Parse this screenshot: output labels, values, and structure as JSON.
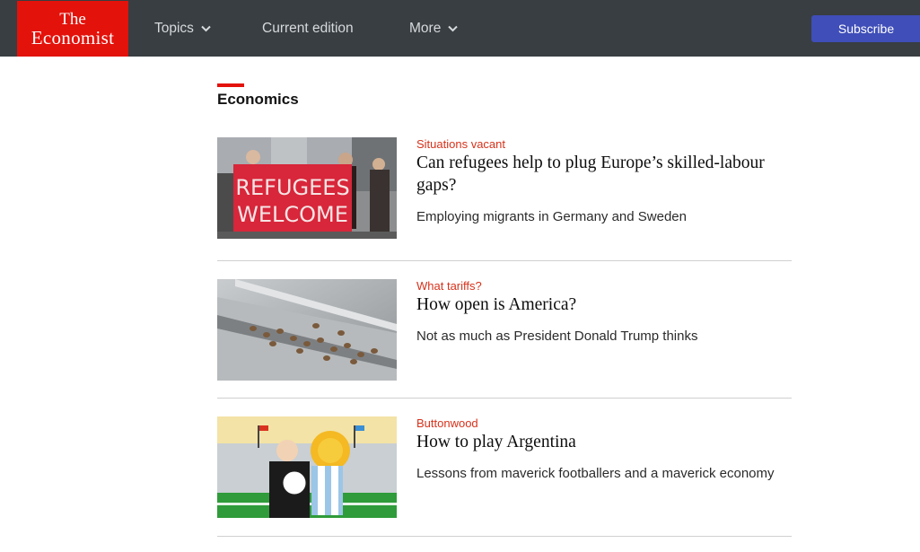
{
  "header": {
    "logo_line1": "The",
    "logo_line2": "Economist",
    "nav": [
      {
        "label": "Topics",
        "icon": "chevron-down-icon"
      },
      {
        "label": "Current edition"
      },
      {
        "label": "More",
        "icon": "chevron-down-icon"
      }
    ],
    "subscribe_label": "Subscribe",
    "colors": {
      "bar": "#383e42",
      "logo": "#e3120b",
      "subscribe": "#3f4eb8"
    }
  },
  "section": {
    "title": "Economics",
    "accent": "#e3120b"
  },
  "articles": [
    {
      "flytitle": "Situations vacant",
      "headline": "Can refugees help to plug Europe’s skilled-labour gaps?",
      "rubric": "Employing migrants in Germany and Sweden",
      "image": {
        "banner_line1": "REFUGEES",
        "banner_line2": "WELCOME"
      }
    },
    {
      "flytitle": "What tariffs?",
      "headline": "How open is America?",
      "rubric": "Not as much as President Donald Trump thinks",
      "image": {}
    },
    {
      "flytitle": "Buttonwood",
      "headline": "How to play Argentina",
      "rubric": "Lessons from maverick footballers and a maverick economy",
      "image": {}
    }
  ]
}
